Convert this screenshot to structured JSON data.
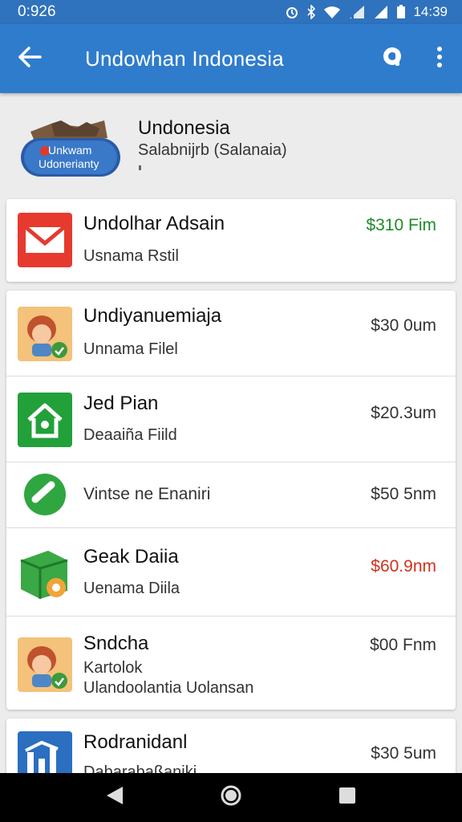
{
  "status_bar": {
    "left_time": "0:926",
    "right_time": "14:39"
  },
  "app_bar": {
    "title": "Undowhan Indonesia"
  },
  "header": {
    "logo_line1": "Unkwam",
    "logo_line2": "Udonerianty",
    "title": "Undonesia",
    "subtitle": "Salabnijrb (Salanaia)"
  },
  "list": [
    {
      "title": "Undolhar Adsain",
      "subtitle": "Usnama Rstil",
      "price": "$310 Fim",
      "price_color": "#1f8a2a",
      "icon": "mail-icon"
    },
    {
      "title": "Undiyanuemiaja",
      "subtitle": "Unnama Filel",
      "price": "$30 0um",
      "icon": "avatar-icon"
    },
    {
      "title": "Jed Pian",
      "subtitle": "Deaaiña Fiild",
      "price": "$20.3um",
      "icon": "home-icon"
    },
    {
      "title": "Vintse ne Enaniri",
      "subtitle": "",
      "price": "$50 5nm",
      "icon": "phone-icon"
    },
    {
      "title": "Geak Daiia",
      "subtitle": "Uenama Diila",
      "price": "$60.9nm",
      "price_color": "#d0311c",
      "icon": "package-icon"
    },
    {
      "title": "Sndcha",
      "subtitle": "Kartolok",
      "subtitle2": "Ulandoolantia Uolansan",
      "price": "$00 Fnm",
      "icon": "avatar-icon"
    },
    {
      "title": "Rodranidanl",
      "subtitle": "Dabarabaßaniki",
      "price": "$30 5um",
      "icon": "chart-icon"
    }
  ]
}
